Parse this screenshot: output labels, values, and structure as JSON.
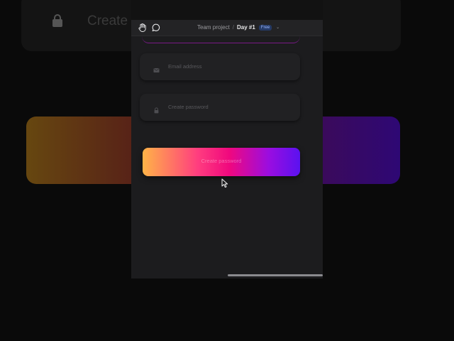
{
  "background": {
    "title_partial": "Create p"
  },
  "toolbar": {
    "hand_icon": "hand-icon",
    "comment_icon": "comment-icon",
    "breadcrumb_project": "Team project",
    "breadcrumb_separator": "/",
    "breadcrumb_page": "Day #1",
    "badge": "Free",
    "caret": "⌄"
  },
  "form": {
    "email_placeholder": "Email address",
    "password_placeholder": "Create password",
    "submit_label": "Create password"
  },
  "colors": {
    "gradient_start": "#ffb347",
    "gradient_mid": "#f0087e",
    "gradient_end": "#5a12f0",
    "panel_bg": "#1c1c1e"
  }
}
